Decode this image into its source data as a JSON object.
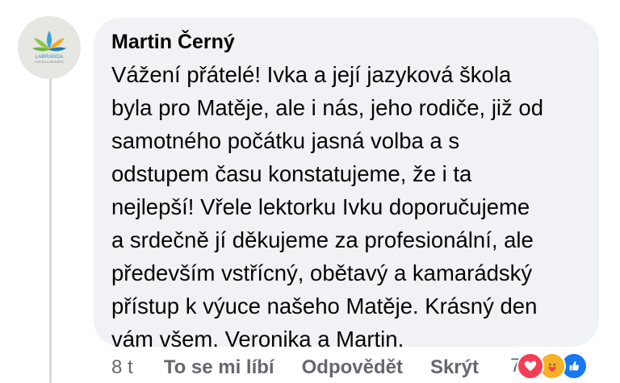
{
  "comment": {
    "author": "Martin Černý",
    "text": "Vážení přátelé! Ivka a její jazyková škola\nbyla pro Matěje, ale i nás, jeho rodiče, již od\nsamotného počátku jasná volba a s\nodstupem času konstatujeme, že i ta\nnejlepší! Vřele lektorku Ivku doporučujeme\na srdečně jí děkujeme za profesionální, ale\npředevším vstřícný, obětavý a kamarádský\npřístup k výuce našeho Matěje. Krásný den\nvám všem. Veronika a Martin.",
    "avatar_text": "LABRANDA",
    "avatar_subtext": "HOTELS & RESORTS"
  },
  "actions": {
    "time": "8 t",
    "like_label": "To se mi líbí",
    "reply_label": "Odpovědět",
    "hide_label": "Skrýt"
  },
  "reactions": {
    "count": "7",
    "icons": [
      "love-icon",
      "care-icon",
      "like-icon"
    ]
  },
  "colors": {
    "bubble": "#f0f2f5",
    "text": "#050505",
    "secondary": "#65676b",
    "love": "#f33e58",
    "care": "#f7b125",
    "like": "#1877f2"
  }
}
